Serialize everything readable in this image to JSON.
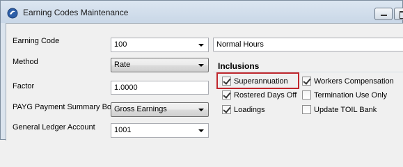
{
  "window": {
    "title": "Earning Codes Maintenance"
  },
  "fields": {
    "earning_code": {
      "label": "Earning Code",
      "value": "100",
      "description": "Normal Hours"
    },
    "method": {
      "label": "Method",
      "value": "Rate"
    },
    "factor": {
      "label": "Factor",
      "value": "1.0000"
    },
    "payg": {
      "label": "PAYG Payment Summary Box",
      "value": "Gross Earnings"
    },
    "gl_account": {
      "label": "General Ledger Account",
      "value": "1001"
    }
  },
  "inclusions": {
    "title": "Inclusions",
    "items": [
      {
        "label": "Superannuation",
        "checked": true,
        "highlighted": true
      },
      {
        "label": "Rostered Days Off",
        "checked": true
      },
      {
        "label": "Loadings",
        "checked": true
      },
      {
        "label": "Workers Compensation",
        "checked": true
      },
      {
        "label": "Termination Use Only",
        "checked": false
      },
      {
        "label": "Update TOIL Bank",
        "checked": false
      }
    ]
  },
  "colors": {
    "highlight": "#c0272d",
    "titlebar": "#c9d7e7"
  }
}
